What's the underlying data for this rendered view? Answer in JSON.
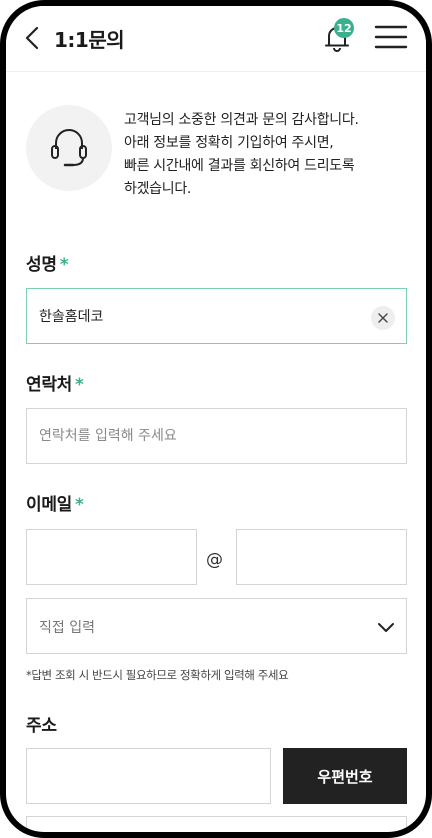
{
  "header": {
    "title": "1:1문의",
    "notification_count": "12"
  },
  "intro": {
    "lines": [
      "고객님의 소중한 의견과 문의 감사합니다.",
      "아래 정보를 정확히 기입하여 주시면,",
      "빠른 시간내에 결과를 회신하여 드리도록",
      "하겠습니다."
    ]
  },
  "form": {
    "name": {
      "label": "성명",
      "required_mark": "*",
      "value": "한솔홈데코"
    },
    "phone": {
      "label": "연락처",
      "required_mark": "*",
      "placeholder": "연락처를 입력해 주세요",
      "value": ""
    },
    "email": {
      "label": "이메일",
      "required_mark": "*",
      "local_value": "",
      "at": "@",
      "domain_value": "",
      "domain_select": {
        "selected": "직접 입력"
      },
      "hint": "*답변 조회 시 반드시 필요하므로 정확하게 입력해 주세요"
    },
    "address": {
      "label": "주소",
      "value": "",
      "zip_button": "우편번호"
    }
  },
  "colors": {
    "accent": "#3bb08f",
    "focus_border": "#7ccfb3",
    "dark_button": "#222222"
  },
  "icons": [
    "back-arrow-icon",
    "bell-icon",
    "hamburger-menu-icon",
    "headset-icon",
    "clear-icon",
    "chevron-down-icon"
  ]
}
